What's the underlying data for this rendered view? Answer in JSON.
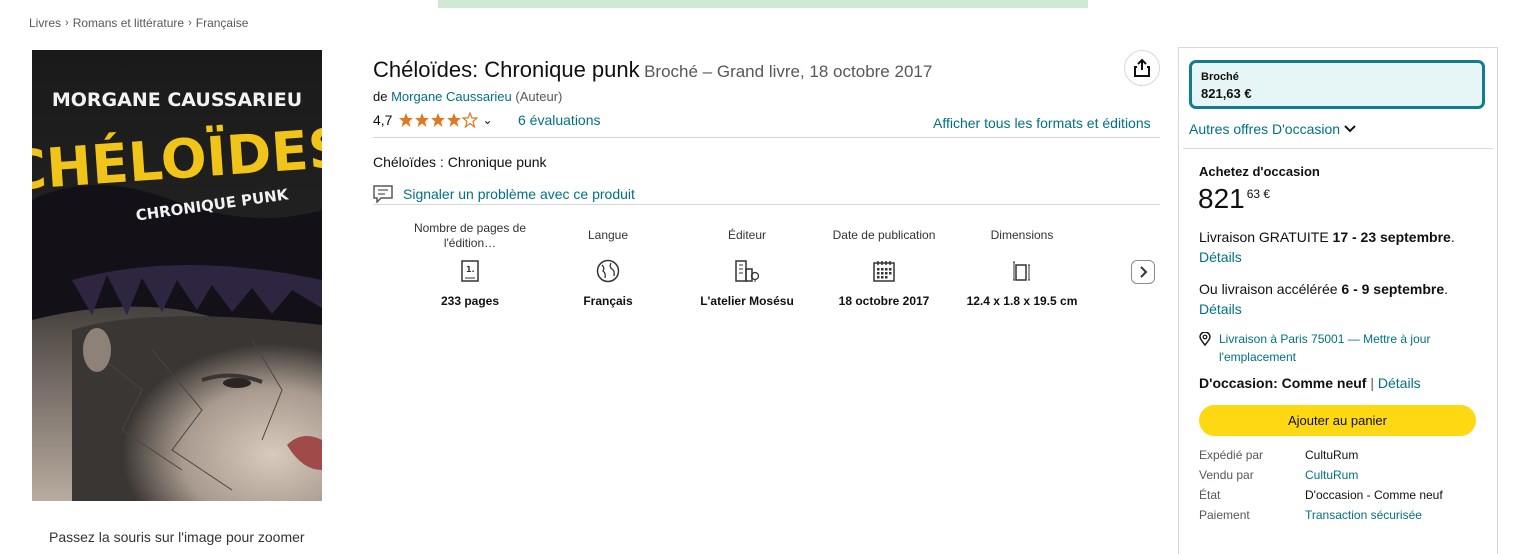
{
  "breadcrumb": [
    "Livres",
    "Romans et littérature",
    "Française"
  ],
  "cover": {
    "author_text": "MORGANE CAUSSARIEU",
    "title_text": "CHÉLOÏDES",
    "subtitle_text": "CHRONIQUE PUNK"
  },
  "zoom_hint": "Passez la souris sur l'image pour zoomer",
  "product": {
    "title": "Chéloïdes: Chronique punk",
    "subtitle": "Broché – Grand livre, 18 octobre 2017",
    "by_prefix": "de",
    "author": "Morgane Caussarieu",
    "author_role": "(Auteur)",
    "rating": "4,7",
    "reviews": "6 évaluations",
    "formats_link": "Afficher tous les formats et éditions",
    "description": "Chéloïdes : Chronique punk",
    "report_link": "Signaler un problème avec ce produit"
  },
  "details": [
    {
      "label": "Nombre de pages de l'édition…",
      "value": "233 pages",
      "icon": "book-pages-icon"
    },
    {
      "label": "Langue",
      "value": "Français",
      "icon": "globe-icon"
    },
    {
      "label": "Éditeur",
      "value": "L'atelier Mosésu",
      "icon": "building-icon"
    },
    {
      "label": "Date de publication",
      "value": "18 octobre 2017",
      "icon": "calendar-icon"
    },
    {
      "label": "Dimensions",
      "value": "12.4 x 1.8 x 19.5 cm",
      "icon": "ruler-icon"
    }
  ],
  "buybox": {
    "format_name": "Broché",
    "format_price": "821,63 €",
    "other_offers": "Autres offres D'occasion",
    "buy_used_title": "Achetez d'occasion",
    "price_whole": "821",
    "price_fraction": "63 €",
    "delivery1_prefix": "Livraison GRATUITE ",
    "delivery1_date": "17 - 23 septembre",
    "delivery1_suffix": ".",
    "delivery2_prefix": "Ou livraison accélérée ",
    "delivery2_date": "6 - 9 septembre",
    "delivery2_suffix": ".",
    "details_link": "Détails",
    "location": "Livraison à Paris 75001 — Mettre à jour l'emplacement",
    "condition_label": "D'occasion: Comme neuf",
    "condition_sep": " | ",
    "add_to_cart": "Ajouter au panier",
    "info": [
      {
        "key": "Expédié par",
        "value": "CultuRum",
        "link": false
      },
      {
        "key": "Vendu par",
        "value": "CultuRum",
        "link": true
      },
      {
        "key": "État",
        "value": "D'occasion - Comme neuf",
        "link": false
      },
      {
        "key": "Paiement",
        "value": "Transaction sécurisée",
        "link": true
      }
    ]
  },
  "colors": {
    "link": "#007185",
    "star": "#de7921",
    "cart_button": "#ffd814",
    "format_border": "#147c8f"
  }
}
